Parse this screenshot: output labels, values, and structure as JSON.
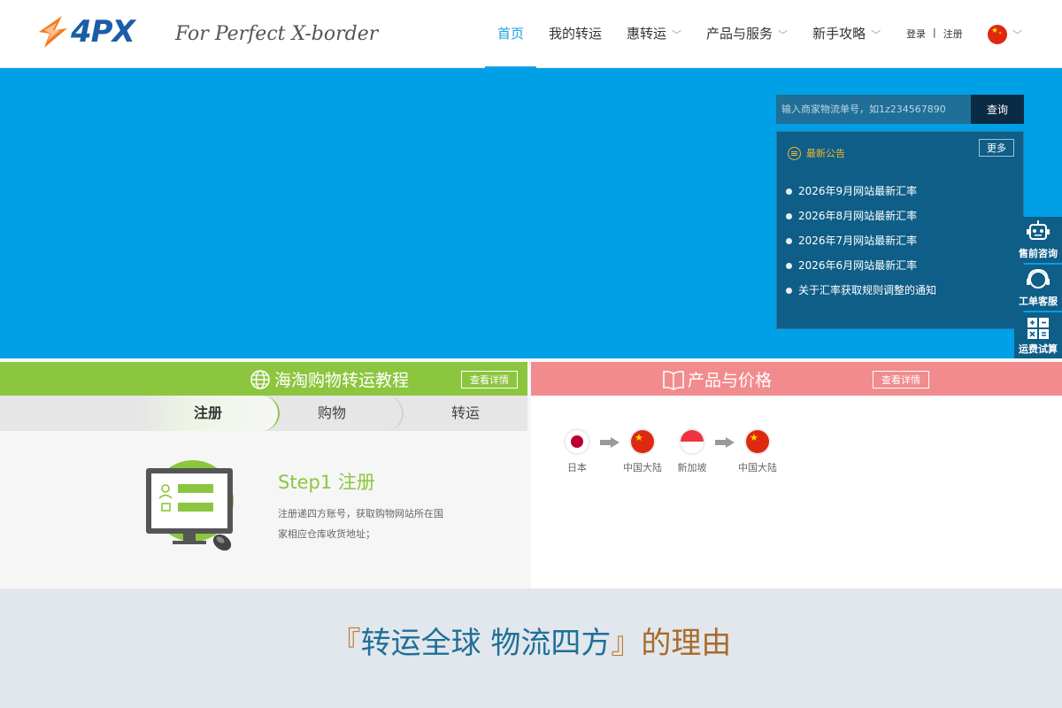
{
  "brand": {
    "logo_text": "4PX",
    "slogan": "For Perfect X-border"
  },
  "nav": {
    "items": [
      {
        "label": "首页",
        "active": true
      },
      {
        "label": "我的转运"
      },
      {
        "label": "惠转运",
        "dropdown": true
      },
      {
        "label": "产品与服务",
        "dropdown": true
      },
      {
        "label": "新手攻略",
        "dropdown": true
      }
    ],
    "login": "登录",
    "separator": "|",
    "register": "注册"
  },
  "search": {
    "placeholder": "输入商家物流单号，如1z234567890",
    "button": "查询"
  },
  "notice": {
    "title": "最新公告",
    "more": "更多",
    "items": [
      "2026年9月网站最新汇率",
      "2026年8月网站最新汇率",
      "2026年7月网站最新汇率",
      "2026年6月网站最新汇率",
      "关于汇率获取规则调整的通知"
    ]
  },
  "side": {
    "presale": "售前咨询",
    "ticket": "工单客服",
    "calc": "运费试算"
  },
  "tutorial": {
    "title": "海淘购物转运教程",
    "detail": "查看详情",
    "tabs": [
      "注册",
      "购物",
      "转运"
    ],
    "step_title": "Step1 注册",
    "step_desc": "注册递四方账号，获取购物网站所在国家相应仓库收货地址；"
  },
  "products": {
    "title": "产品与价格",
    "detail": "查看详情",
    "routes": [
      {
        "from": "日本",
        "to": "中国大陆"
      },
      {
        "from": "新加坡",
        "to": "中国大陆"
      }
    ]
  },
  "reason": {
    "open": "『",
    "main": "转运全球 物流四方",
    "close": "』",
    "tail": "的理由"
  },
  "colors": {
    "primary": "#00a0e6",
    "green": "#8cc63f",
    "pink": "#f28b8e",
    "dark": "#0f5e88"
  }
}
